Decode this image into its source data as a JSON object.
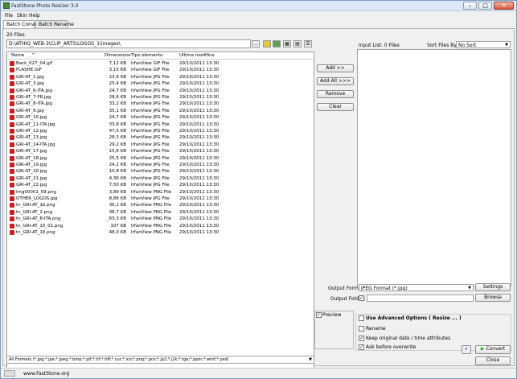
{
  "window": {
    "title": "FastStone Photo Resizer 3.0"
  },
  "menu": [
    "File",
    "Skin",
    "Help"
  ],
  "tabs": [
    {
      "label": "Batch Convert",
      "active": true
    },
    {
      "label": "Batch Rename",
      "active": false
    }
  ],
  "file_count": "20 Files",
  "path": "D:\\ATHIQ_WEB-3\\CLIP_ARTS\\LOGOS_1\\images\\",
  "columns": {
    "name": "Nome",
    "size": "Dimensione",
    "type": "Tipo elemento",
    "modified": "Ultima modifica"
  },
  "files": [
    {
      "name": "Back_027_04.gif",
      "size": "7,12 KB",
      "type": "IrfanView GIF File",
      "modified": "29/10/2011 13:30"
    },
    {
      "name": "FLASHE.GIF",
      "size": "3,15 KB",
      "type": "IrfanView GIF File",
      "modified": "29/10/2011 13:30"
    },
    {
      "name": "GRI-AT_1.jpg",
      "size": "23,9 KB",
      "type": "IrfanView JPG File",
      "modified": "29/10/2011 13:30"
    },
    {
      "name": "GRI-AT_3.jpg",
      "size": "25,4 KB",
      "type": "IrfanView JPG File",
      "modified": "29/10/2011 13:30"
    },
    {
      "name": "GRI-AT_6-ITA.jpg",
      "size": "24,7 KB",
      "type": "IrfanView JPG File",
      "modified": "29/10/2011 13:30"
    },
    {
      "name": "GRI-AT_7-FR.jpg",
      "size": "28,6 KB",
      "type": "IrfanView JPG File",
      "modified": "29/10/2011 13:30"
    },
    {
      "name": "GRI-AT_8-ITA.jpg",
      "size": "33,2 KB",
      "type": "IrfanView JPG File",
      "modified": "29/10/2011 13:30"
    },
    {
      "name": "GRI-AT_9.jpg",
      "size": "35,1 KB",
      "type": "IrfanView JPG File",
      "modified": "29/10/2011 13:30"
    },
    {
      "name": "GRI-AT_10.jpg",
      "size": "24,7 KB",
      "type": "IrfanView JPG File",
      "modified": "29/10/2011 13:30"
    },
    {
      "name": "GRI-AT_11-ITA.jpg",
      "size": "33,8 KB",
      "type": "IrfanView JPG File",
      "modified": "29/10/2011 13:30"
    },
    {
      "name": "GRI-AT_12.jpg",
      "size": "47,5 KB",
      "type": "IrfanView JPG File",
      "modified": "29/10/2011 13:30"
    },
    {
      "name": "GRI-AT_13.jpg",
      "size": "28,3 KB",
      "type": "IrfanView JPG File",
      "modified": "29/10/2011 13:30"
    },
    {
      "name": "GRI-AT_14-ITA.jpg",
      "size": "29,2 KB",
      "type": "IrfanView JPG File",
      "modified": "29/10/2011 13:30"
    },
    {
      "name": "GRI-AT_17.jpg",
      "size": "15,6 KB",
      "type": "IrfanView JPG File",
      "modified": "29/10/2011 13:30"
    },
    {
      "name": "GRI-AT_18.jpg",
      "size": "25,5 KB",
      "type": "IrfanView JPG File",
      "modified": "29/10/2011 13:30"
    },
    {
      "name": "GRI-AT_19.jpg",
      "size": "24,2 KB",
      "type": "IrfanView JPG File",
      "modified": "29/10/2011 13:30"
    },
    {
      "name": "GRI-AT_20.jpg",
      "size": "10,8 KB",
      "type": "IrfanView JPG File",
      "modified": "29/10/2011 13:30"
    },
    {
      "name": "GRI-AT_21.jpg",
      "size": "4,36 KB",
      "type": "IrfanView JPG File",
      "modified": "29/10/2011 13:30"
    },
    {
      "name": "GRI-AT_22.jpg",
      "size": "7,50 KB",
      "type": "IrfanView JPG File",
      "modified": "29/10/2011 13:30"
    },
    {
      "name": "img00001_09.png",
      "size": "3,89 KB",
      "type": "IrfanView PNG File",
      "modified": "29/10/2011 13:30"
    },
    {
      "name": "OTHER_LOGOS.jpg",
      "size": "8,86 KB",
      "type": "IrfanView JPG File",
      "modified": "29/10/2011 13:30"
    },
    {
      "name": "tn_GRI-AT_1b.png",
      "size": "36,1 KB",
      "type": "IrfanView PNG File",
      "modified": "29/10/2011 13:30"
    },
    {
      "name": "tn_GRI-AT_2.png",
      "size": "38,7 KB",
      "type": "IrfanView PNG File",
      "modified": "29/10/2011 13:30"
    },
    {
      "name": "tn_GRI-AT_8-ITA.png",
      "size": "63,3 KB",
      "type": "IrfanView PNG File",
      "modified": "29/10/2011 13:30"
    },
    {
      "name": "tn_GRI-AT_15_01.png",
      "size": "107 KB",
      "type": "IrfanView PNG File",
      "modified": "29/10/2011 13:30"
    },
    {
      "name": "tn_GRI-AT_16.png",
      "size": "48,0 KB",
      "type": "IrfanView PNG File",
      "modified": "29/10/2011 13:30"
    }
  ],
  "filter": "All Formats (*.jpg;*.jpe;*.jpeg;*.bmp;*.gif;*.tif;*.tiff;*.cur;*.ico;*.png;*.pcx;*.jp2;*.j2k;*.tga;*.ppm;*.wmf;*.psd)",
  "buttons": {
    "add": "Add >>",
    "add_all": "Add All >>>",
    "remove": "Remove",
    "clear": "Clear",
    "settings": "Settings",
    "browse": "Browse",
    "convert": "Convert",
    "close": "Close"
  },
  "input_list": {
    "label": "Input List: 0 Files",
    "sort_label": "Sort Files By:",
    "sort_value": "No Sort"
  },
  "output": {
    "format_label": "Output Format:",
    "format_value": "JPEG Format (*.jpg)",
    "folder_label": "Output Folder:",
    "folder_value": ""
  },
  "options": {
    "preview": "Preview",
    "advanced": "Use Advanced Options ( Resize ... )",
    "rename": "Rename",
    "keep_date": "Keep original date / time attributes",
    "ask_overwrite": "Ask before overwrite"
  },
  "checks": {
    "preview": true,
    "advanced": false,
    "rename": false,
    "keep_date": true,
    "ask_overwrite": true,
    "folder": true
  },
  "footer": {
    "url": "www.FastStone.org"
  },
  "colors": {
    "accent": "#cc1e1e",
    "convert_arrow": "#2a9a2a"
  }
}
